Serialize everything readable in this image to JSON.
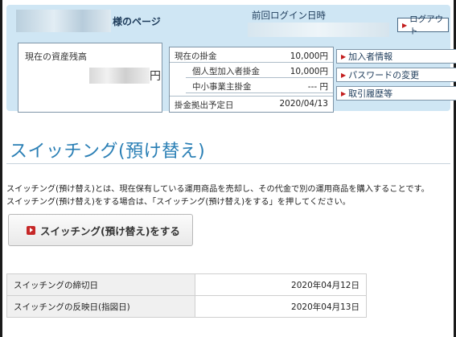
{
  "header": {
    "honorific": "様のページ",
    "last_login_label": "前回ログイン日時",
    "logout_label": "ログアウト"
  },
  "balance": {
    "label": "現在の資産残高",
    "unit": "円"
  },
  "contributions": {
    "current_label": "現在の掛金",
    "current_value": "10,000円",
    "individual_label": "個人型加入者掛金",
    "individual_value": "10,000円",
    "sme_label": "中小事業主掛金",
    "sme_value": "--- 円",
    "date_label": "掛金拠出予定日",
    "date_value": "2020/04/13"
  },
  "side_menu": [
    {
      "label": "加入者情報"
    },
    {
      "label": "パスワードの変更"
    },
    {
      "label": "取引履歴等"
    }
  ],
  "page": {
    "title": "スイッチング(預け替え)",
    "desc_line1": "スイッチング(預け替え)とは、現在保有している運用商品を売却し、その代金で別の運用商品を購入することです。",
    "desc_line2": "スイッチング(預け替え)をする場合は、「スイッチング(預け替え)をする」を押してください。",
    "switch_button": "スイッチング(預け替え)をする"
  },
  "schedule": [
    {
      "label": "スイッチングの締切日",
      "value": "2020年04月12日"
    },
    {
      "label": "スイッチングの反映日(指図日)",
      "value": "2020年04月13日"
    }
  ],
  "colors": {
    "accent": "#2a7fb5",
    "panel": "#cfe6f4",
    "marker": "#c62828"
  }
}
